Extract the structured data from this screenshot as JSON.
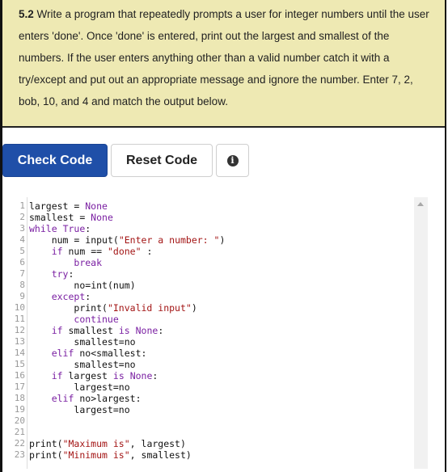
{
  "prompt": {
    "number": "5.2",
    "text": " Write a program that repeatedly prompts a user for integer numbers until the user enters 'done'. Once 'done' is entered, print out the largest and smallest of the numbers. If the user enters anything other than a valid number catch it with a try/except and put out an appropriate message and ignore the number. Enter 7, 2, bob, 10, and 4 and match the output below."
  },
  "buttons": {
    "check": "Check Code",
    "reset": "Reset Code",
    "info": "i"
  },
  "icons": {
    "info": "info-circle-icon",
    "scroll_up": "chevron-up-icon"
  },
  "editor": {
    "line_numbers": [
      "1",
      "2",
      "3",
      "4",
      "5",
      "6",
      "7",
      "8",
      "9",
      "10",
      "11",
      "12",
      "13",
      "14",
      "15",
      "16",
      "17",
      "18",
      "19",
      "20",
      "21",
      "22",
      "23"
    ],
    "lines": [
      "largest = None",
      "smallest = None",
      "while True:",
      "    num = input(\"Enter a number: \")",
      "    if num == \"done\" :",
      "        break",
      "    try:",
      "        no=int(num)",
      "    except:",
      "        print(\"Invalid input\")",
      "        continue",
      "    if smallest is None:",
      "        smallest=no",
      "    elif no<smallest:",
      "        smallest=no",
      "    if largest is None:",
      "        largest=no",
      "    elif no>largest:",
      "        largest=no",
      "",
      "",
      "print(\"Maximum is\", largest)",
      "print(\"Minimum is\", smallest)"
    ]
  }
}
